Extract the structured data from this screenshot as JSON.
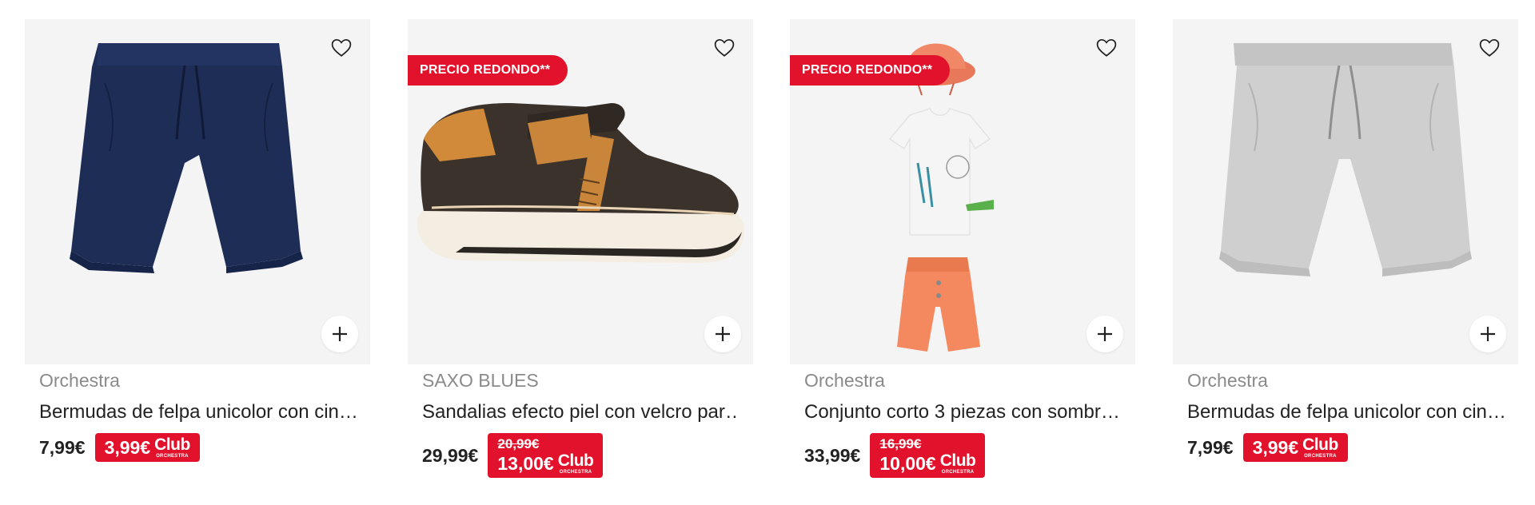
{
  "products": [
    {
      "brand": "Orchestra",
      "name": "Bermudas de felpa unicolor con cin…",
      "price": "7,99€",
      "badge": "",
      "club_old": "",
      "club_price": "3,99€",
      "image": "navy-shorts"
    },
    {
      "brand": "SAXO BLUES",
      "name": "Sandalias efecto piel con velcro par…",
      "price": "29,99€",
      "badge": "PRECIO REDONDO**",
      "club_old": "20,99€",
      "club_price": "13,00€",
      "image": "brown-sandal"
    },
    {
      "brand": "Orchestra",
      "name": "Conjunto corto 3 piezas con sombr…",
      "price": "33,99€",
      "badge": "PRECIO REDONDO**",
      "club_old": "16,99€",
      "club_price": "10,00€",
      "image": "baby-set"
    },
    {
      "brand": "Orchestra",
      "name": "Bermudas de felpa unicolor con cin…",
      "price": "7,99€",
      "badge": "",
      "club_old": "",
      "club_price": "3,99€",
      "image": "grey-shorts"
    }
  ],
  "club_logo": {
    "word": "Club",
    "sub": "ORCHESTRA"
  },
  "icons": {
    "favorite": "heart-outline-icon",
    "add": "plus-icon"
  },
  "colors": {
    "accent": "#e3122c",
    "brand_text": "#8a8a8a",
    "card_bg": "#f4f4f4"
  }
}
